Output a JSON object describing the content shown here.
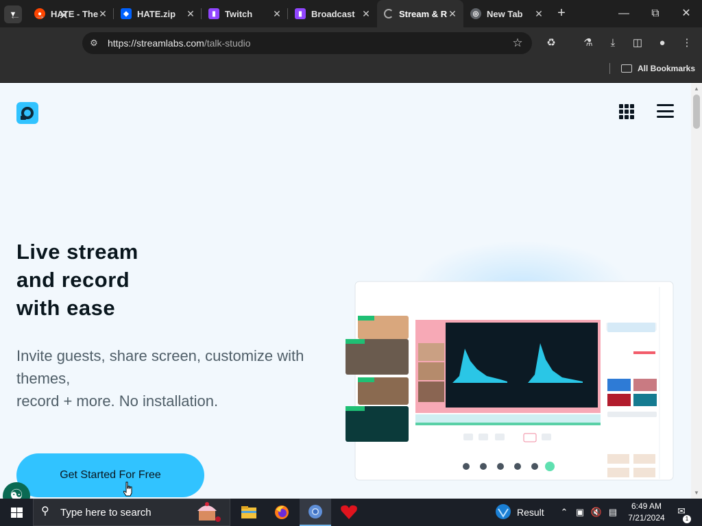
{
  "browser": {
    "tabs": [
      {
        "title": "HATE - The",
        "favicon": "reddit-icon",
        "color": "#ff4500"
      },
      {
        "title": "HATE.zip",
        "favicon": "dropbox-icon",
        "color": "#0061fe"
      },
      {
        "title": "Twitch",
        "favicon": "twitch-icon",
        "color": "#9146ff"
      },
      {
        "title": "Broadcast",
        "favicon": "twitch-icon",
        "color": "#9146ff"
      },
      {
        "title": "Stream & R",
        "favicon": "loading-spinner-icon",
        "color": "#2e2e2e"
      },
      {
        "title": "New Tab",
        "favicon": "globe-icon",
        "color": "#5f6368"
      }
    ],
    "active_tab_index": 4,
    "url_host": "https://streamlabs.com",
    "url_path": "/talk-studio",
    "bookmarks_label": "All Bookmarks"
  },
  "page": {
    "brand_color": "#31c3ff",
    "hero_title_lines": [
      "Live stream",
      "and record",
      "with ease"
    ],
    "hero_sub_lines": [
      "Invite guests, share screen, customize with themes,",
      "record + more. No installation."
    ],
    "cta_label": "Get Started For Free"
  },
  "taskbar": {
    "search_placeholder": "Type here to search",
    "tray_result_label": "Result",
    "time": "6:49 AM",
    "date": "7/21/2024",
    "notification_count": "1"
  }
}
